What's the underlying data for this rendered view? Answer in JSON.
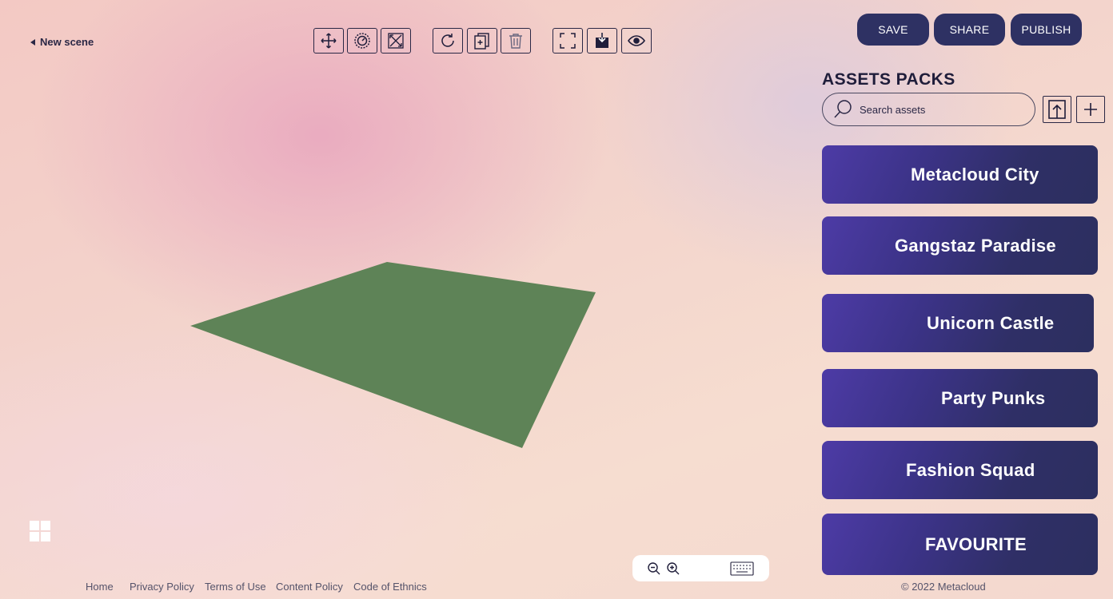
{
  "header": {
    "back_label": "New scene",
    "save_label": "SAVE",
    "share_label": "SHARE",
    "publish_label": "PUBLISH"
  },
  "toolbar": {
    "icons": [
      "move-icon",
      "rotate-gizmo-icon",
      "scale-icon",
      "refresh-icon",
      "duplicate-icon",
      "trash-icon",
      "fullscreen-icon",
      "download-icon",
      "eye-icon"
    ]
  },
  "panel": {
    "title": "ASSETS PACKS",
    "search_placeholder": "Search assets",
    "packs": [
      {
        "label": "Metacloud City"
      },
      {
        "label": "Gangstaz Paradise"
      },
      {
        "label": "Unicorn Castle"
      },
      {
        "label": "Party Punks"
      },
      {
        "label": "Fashion Squad"
      },
      {
        "label": "FAVOURITE"
      }
    ]
  },
  "viewport": {
    "ground_color": "#5e8357"
  },
  "footer": {
    "links": [
      "Home",
      "Privacy Policy",
      "Terms of Use",
      "Content Policy",
      "Code of Ethnics"
    ],
    "copyright": "©  2022 Metacloud"
  },
  "colors": {
    "accent": "#2e3163",
    "text_dark": "#2a2745"
  }
}
